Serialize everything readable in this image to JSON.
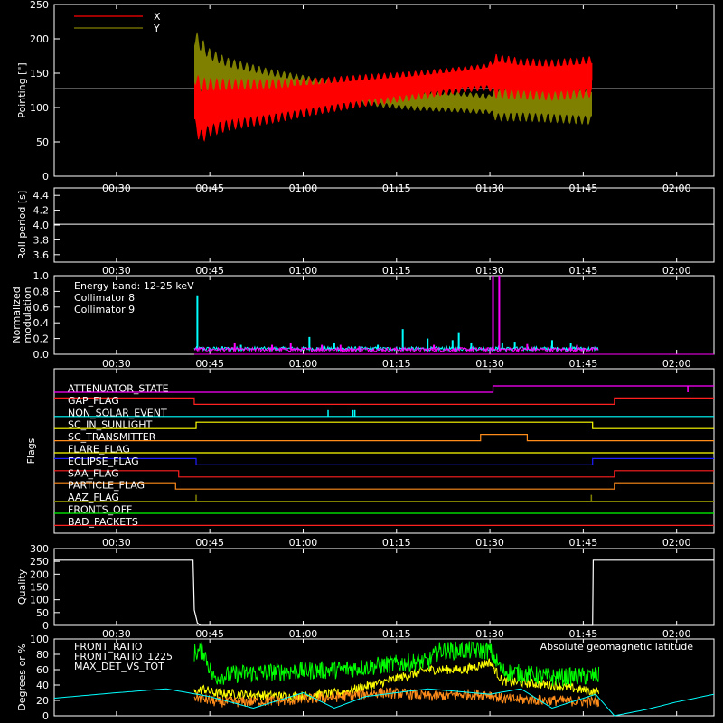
{
  "time_axis": {
    "tick_labels": [
      "00:30",
      "00:45",
      "01:00",
      "01:15",
      "01:30",
      "01:45",
      "02:00"
    ],
    "ticks_min": [
      30,
      45,
      60,
      75,
      90,
      105,
      120
    ],
    "range_min": [
      20,
      126
    ]
  },
  "chart_data": [
    {
      "type": "line",
      "ylabel": "Pointing [\"]",
      "ylim": [
        0,
        250
      ],
      "yticks": [
        "0",
        "50",
        "100",
        "150",
        "200",
        "250"
      ],
      "yticks_values": [
        0,
        50,
        100,
        150,
        200,
        250
      ],
      "reference_line": 128,
      "legend": [
        {
          "name": "X",
          "color": "#ff0000"
        },
        {
          "name": "Y",
          "color": "#808000"
        }
      ],
      "series": [
        {
          "name": "X",
          "color": "#ff0000",
          "x_start": 42.5,
          "x_end": 106.5,
          "envelope_x": [
            42.5,
            43.5,
            45,
            48,
            55,
            62,
            70,
            77,
            85,
            88,
            90,
            91,
            95,
            100,
            106.5
          ],
          "center": [
            110,
            95,
            100,
            104,
            109,
            116,
            125,
            131,
            140,
            143,
            145,
            146,
            142,
            140,
            145
          ],
          "halfwidth": [
            40,
            45,
            40,
            35,
            30,
            25,
            22,
            20,
            18,
            18,
            20,
            30,
            28,
            28,
            28
          ]
        },
        {
          "name": "Y",
          "color": "#808000",
          "x_start": 42.5,
          "x_end": 106.5,
          "envelope_x": [
            42.5,
            43.5,
            45,
            48,
            55,
            62,
            70,
            77,
            85,
            88,
            90,
            91,
            95,
            100,
            106.5
          ],
          "center": [
            160,
            155,
            148,
            140,
            132,
            126,
            119,
            112,
            108,
            106,
            105,
            107,
            110,
            108,
            105
          ],
          "halfwidth": [
            50,
            45,
            35,
            30,
            22,
            17,
            15,
            15,
            14,
            14,
            13,
            25,
            28,
            28,
            28
          ]
        }
      ]
    },
    {
      "type": "line",
      "ylabel": "Roll period [s]",
      "ylim": [
        3.5,
        4.5
      ],
      "yticks": [
        "3.6",
        "3.8",
        "4.0",
        "4.2",
        "4.4"
      ],
      "yticks_values": [
        3.6,
        3.8,
        4.0,
        4.2,
        4.4
      ],
      "series": [
        {
          "name": "",
          "color": "#ffffff",
          "x": [
            20,
            126
          ],
          "y": [
            4.01,
            4.01
          ]
        }
      ]
    },
    {
      "type": "line",
      "ylabel": "Normalized modulation",
      "ylim": [
        0,
        1.0
      ],
      "yticks": [
        "0.0",
        "0.2",
        "0.4",
        "0.6",
        "0.8",
        "1.0"
      ],
      "yticks_values": [
        0,
        0.2,
        0.4,
        0.6,
        0.8,
        1.0
      ],
      "annotation": "Energy band: 12-25 keV",
      "legend": [
        {
          "name": "Collimator 8",
          "color": "#00ffff"
        },
        {
          "name": "Collimator 9",
          "color": "#ff00ff"
        }
      ],
      "series": [
        {
          "name": "Collimator 8",
          "color": "#00ffff",
          "x_start": 42.5,
          "x_end": 107.5,
          "baseline": 0.07,
          "spikes": [
            [
              43,
              0.75
            ],
            [
              47,
              0.1
            ],
            [
              50,
              0.12
            ],
            [
              61,
              0.22
            ],
            [
              65,
              0.15
            ],
            [
              72,
              0.12
            ],
            [
              76,
              0.32
            ],
            [
              80,
              0.2
            ],
            [
              84,
              0.18
            ],
            [
              85,
              0.28
            ],
            [
              87,
              0.15
            ],
            [
              92,
              0.15
            ],
            [
              94,
              0.16
            ],
            [
              100,
              0.18
            ],
            [
              103,
              0.14
            ]
          ]
        },
        {
          "name": "Collimator 9",
          "color": "#ff00ff",
          "x_start": 42.5,
          "x_end": 107.5,
          "baseline": 0.06,
          "spikes": [
            [
              49,
              0.15
            ],
            [
              55,
              0.12
            ],
            [
              58,
              0.15
            ],
            [
              63,
              0.12
            ],
            [
              66,
              0.12
            ],
            [
              69,
              0.1
            ],
            [
              81,
              0.12
            ],
            [
              90.5,
              1.0
            ],
            [
              91.5,
              1.0
            ],
            [
              96,
              0.13
            ],
            [
              104,
              0.12
            ]
          ]
        }
      ]
    },
    {
      "type": "line",
      "ylabel": "Flags",
      "flags": [
        {
          "name": "ATTENUATOR_STATE",
          "color": "#ff00ff",
          "low_until": 90.5,
          "steps": [
            [
              20,
              0
            ],
            [
              90.5,
              1
            ]
          ],
          "spikes": [
            [
              121.8,
              -1
            ]
          ]
        },
        {
          "name": "GAP_FLAG",
          "color": "#ff2020",
          "steps": [
            [
              20,
              1
            ],
            [
              42.5,
              0
            ],
            [
              110,
              1
            ]
          ]
        },
        {
          "name": "NON_SOLAR_EVENT",
          "color": "#00ffff",
          "steps": [
            [
              20,
              0
            ]
          ],
          "spikes": [
            [
              64,
              1
            ],
            [
              68,
              1
            ],
            [
              68.3,
              1
            ]
          ]
        },
        {
          "name": "SC_IN_SUNLIGHT",
          "color": "#ffff00",
          "steps": [
            [
              20,
              0
            ],
            [
              42.8,
              1
            ],
            [
              106.5,
              0
            ]
          ]
        },
        {
          "name": "SC_TRANSMITTER",
          "color": "#ff8c1a",
          "steps": [
            [
              20,
              0
            ],
            [
              88.5,
              1
            ],
            [
              96,
              0
            ]
          ]
        },
        {
          "name": "FLARE_FLAG",
          "color": "#ffff00",
          "steps": [
            [
              20,
              0
            ]
          ]
        },
        {
          "name": "ECLIPSE_FLAG",
          "color": "#1e1eff",
          "steps": [
            [
              20,
              1
            ],
            [
              42.8,
              0
            ],
            [
              106.5,
              1
            ]
          ]
        },
        {
          "name": "SAA_FLAG",
          "color": "#ff2020",
          "steps": [
            [
              20,
              1
            ],
            [
              40,
              0
            ],
            [
              110,
              1
            ]
          ]
        },
        {
          "name": "PARTICLE_FLAG",
          "color": "#ff8c1a",
          "steps": [
            [
              20,
              1
            ],
            [
              39.5,
              0
            ],
            [
              110,
              1
            ]
          ]
        },
        {
          "name": "AAZ_FLAG",
          "color": "#808000",
          "steps": [
            [
              20,
              0
            ]
          ],
          "spikes": [
            [
              42.8,
              1
            ],
            [
              106.3,
              1
            ]
          ]
        },
        {
          "name": "FRONTS_OFF",
          "color": "#00ff00",
          "steps": [
            [
              20,
              0
            ]
          ]
        },
        {
          "name": "BAD_PACKETS",
          "color": "#ff2020",
          "steps": [
            [
              20,
              0
            ]
          ]
        }
      ]
    },
    {
      "type": "line",
      "ylabel": "Quality",
      "ylim": [
        0,
        300
      ],
      "yticks": [
        "0",
        "50",
        "100",
        "150",
        "200",
        "250",
        "300"
      ],
      "yticks_values": [
        0,
        50,
        100,
        150,
        200,
        250,
        300
      ],
      "series": [
        {
          "name": "",
          "color": "#ffffff",
          "x": [
            20,
            42.3,
            42.5,
            43.0,
            43.5,
            106.5,
            106.6,
            126
          ],
          "y": [
            255,
            255,
            60,
            10,
            0,
            0,
            255,
            255
          ]
        }
      ]
    },
    {
      "type": "line",
      "ylabel": "Degrees or %",
      "ylim": [
        0,
        100
      ],
      "yticks": [
        "0",
        "20",
        "40",
        "60",
        "80",
        "100"
      ],
      "yticks_values": [
        0,
        20,
        40,
        60,
        80,
        100
      ],
      "legend": [
        {
          "name": "FRONT_RATIO",
          "color": "#ffff00"
        },
        {
          "name": "FRONT_RATIO_1225",
          "color": "#00ff00"
        },
        {
          "name": "MAX_DET_VS_TOT",
          "color": "#ff8c1a"
        }
      ],
      "annotation": "Absolute geomagnetic latitude",
      "annotation_color": "#00ffff",
      "series": [
        {
          "name": "FRONT_RATIO",
          "color": "#ffff00",
          "x": [
            42.5,
            44,
            45.5,
            58,
            66,
            72,
            78,
            80,
            86,
            90,
            92,
            100,
            107.5
          ],
          "y": [
            30,
            35,
            30,
            25,
            30,
            42,
            55,
            60,
            60,
            70,
            45,
            40,
            30
          ],
          "noise": 6
        },
        {
          "name": "FRONT_RATIO_1225",
          "color": "#00ff00",
          "x": [
            42.5,
            44,
            45.5,
            50,
            58,
            66,
            72,
            78,
            80,
            82,
            86,
            90,
            92,
            100,
            107.5
          ],
          "y": [
            82,
            85,
            50,
            55,
            58,
            60,
            65,
            70,
            70,
            85,
            85,
            85,
            58,
            50,
            52
          ],
          "noise": 12
        },
        {
          "name": "MAX_DET_VS_TOT",
          "color": "#ff8c1a",
          "x": [
            42.5,
            46,
            50,
            58,
            66,
            72,
            78,
            80,
            86,
            90,
            92,
            100,
            107.5
          ],
          "y": [
            25,
            18,
            18,
            20,
            25,
            30,
            28,
            25,
            28,
            28,
            22,
            20,
            18
          ],
          "noise": 7
        },
        {
          "name": "Absolute geomagnetic latitude",
          "color": "#00ffff",
          "x": [
            20,
            30,
            38,
            45,
            52,
            60,
            65,
            70,
            80,
            90,
            95,
            100,
            107,
            110,
            115,
            120,
            126
          ],
          "y": [
            23,
            30,
            35,
            25,
            10,
            30,
            10,
            25,
            35,
            28,
            35,
            10,
            28,
            0,
            8,
            18,
            28
          ]
        }
      ]
    }
  ]
}
